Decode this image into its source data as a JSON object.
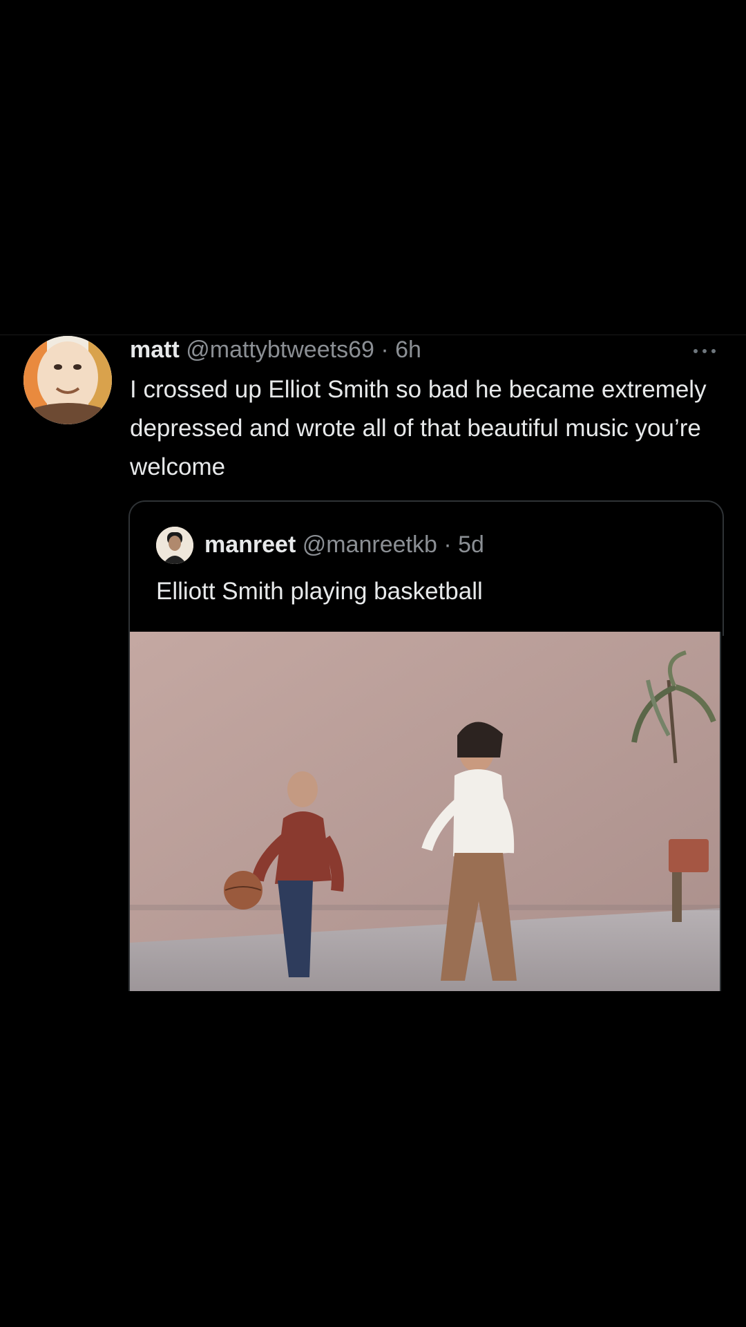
{
  "tweet": {
    "display_name": "matt",
    "handle": "@mattybtweets69",
    "separator": "·",
    "time": "6h",
    "text": "I crossed up Elliot Smith so bad he became extremely depressed and wrote all of that beautiful music you’re welcome",
    "avatar_icon": "cartoon-face-avatar",
    "more_icon": "more-options-icon"
  },
  "quote": {
    "display_name": "manreet",
    "handle": "@manreetkb",
    "separator": "·",
    "time": "5d",
    "text": "Elliott Smith playing basketball",
    "avatar_icon": "profile-photo-avatar"
  },
  "media": {
    "type": "photo",
    "subject": "two people playing basketball in front of a wall"
  },
  "colors": {
    "background": "#000000",
    "primary_text": "#e7e9ea",
    "secondary_text": "#8b8f94",
    "border": "#2f3336"
  }
}
